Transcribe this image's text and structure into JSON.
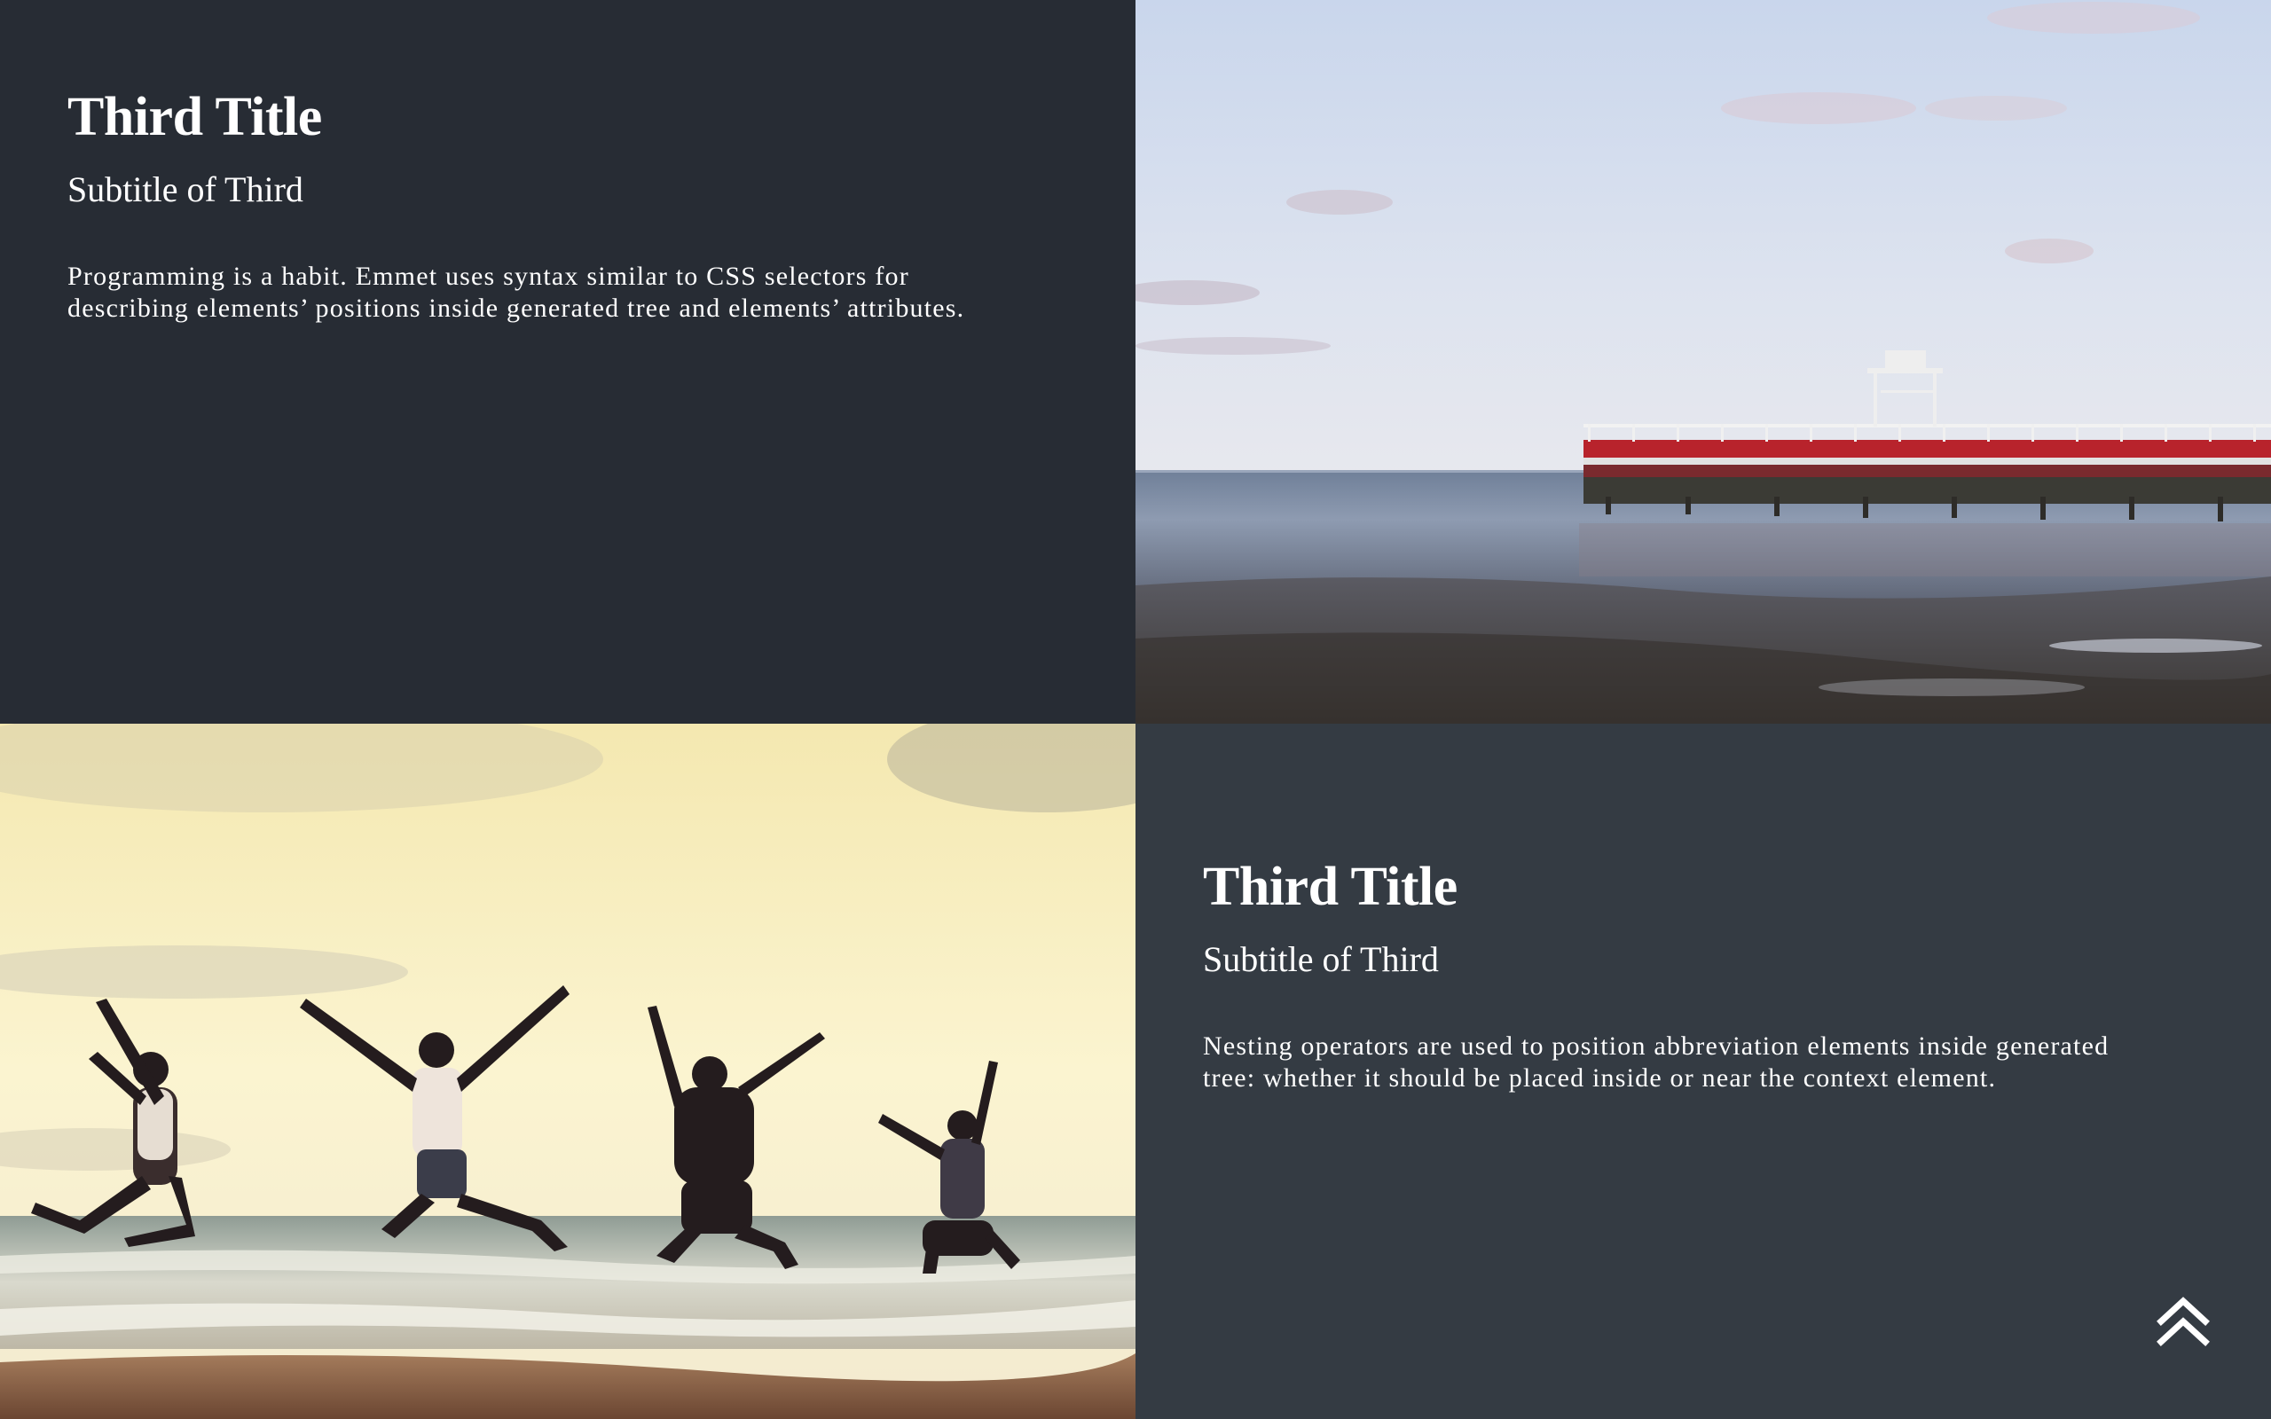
{
  "sections": [
    {
      "title": "Third Title",
      "subtitle": "Subtitle of Third",
      "body": "Programming is a habit. Emmet uses syntax similar to CSS selectors for describing elements’ positions inside generated tree and elements’ attributes."
    },
    {
      "title": "Third Title",
      "subtitle": "Subtitle of Third",
      "body": "Nesting operators are used to position abbreviation elements inside generated tree: whether it should be placed inside or near the context element."
    }
  ],
  "photos": [
    {
      "subject": "pier-over-sea-at-low-tide"
    },
    {
      "subject": "people-jumping-on-beach"
    }
  ],
  "colors": {
    "panel_dark": "#272c34",
    "panel_slate": "#343b43",
    "text": "#ffffff"
  },
  "icons": {
    "scroll_top": "double-chevron-up-icon"
  }
}
